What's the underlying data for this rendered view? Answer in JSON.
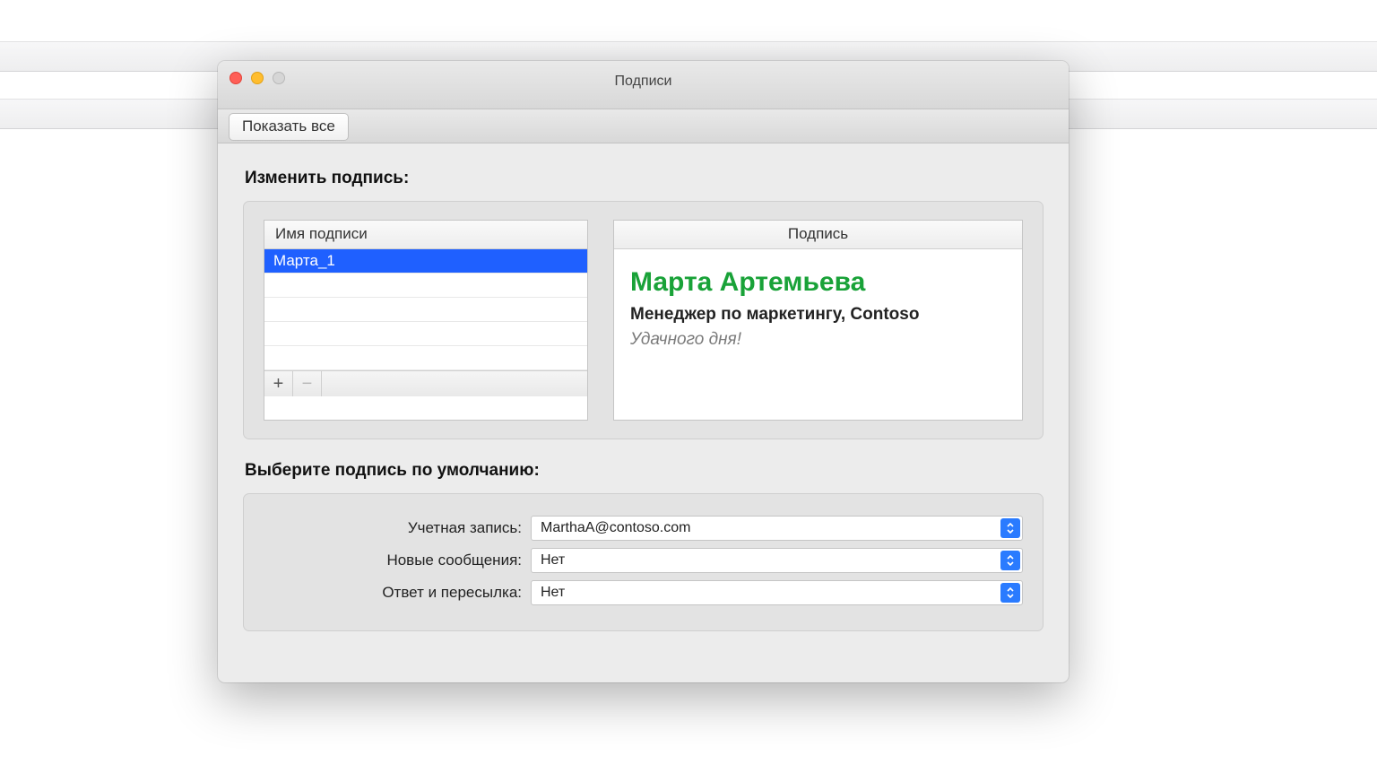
{
  "window": {
    "title": "Подписи",
    "show_all_label": "Показать все"
  },
  "edit": {
    "heading": "Изменить подпись:",
    "name_column": "Имя подписи",
    "signature_column": "Подпись",
    "items": [
      {
        "label": "Марта_1",
        "selected": true
      }
    ],
    "add_label": "+",
    "remove_label": "−"
  },
  "preview": {
    "name": "Марта Артемьева",
    "title": "Менеджер по маркетингу, Contoso",
    "tagline": "Удачного дня!"
  },
  "defaults": {
    "heading": "Выберите подпись по умолчанию:",
    "account_label": "Учетная запись:",
    "account_value": "MarthaA@contoso.com",
    "new_label": "Новые сообщения:",
    "new_value": "Нет",
    "reply_label": "Ответ и пересылка:",
    "reply_value": "Нет"
  }
}
